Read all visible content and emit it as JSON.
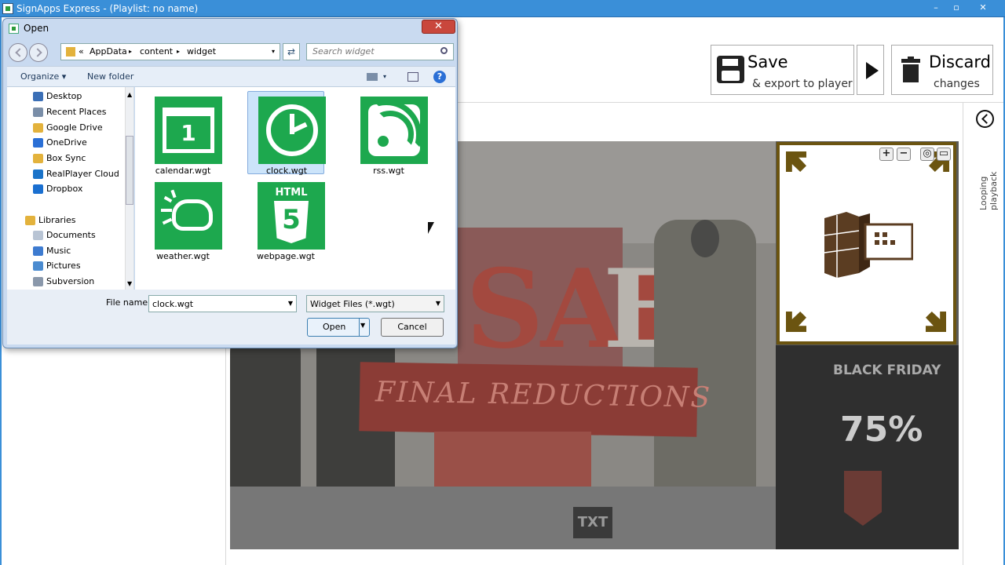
{
  "app": {
    "window_title": "SignApps Express - (Playlist: no name)",
    "window_controls": [
      "–",
      "▫",
      "✕"
    ]
  },
  "toolbar": {
    "save_label": "Save",
    "save_sub": "& export to player",
    "discard_label": "Discard",
    "discard_sub": "changes",
    "looping_label": "Looping playback"
  },
  "stage": {
    "banner_text": "FINAL REDUCTIONS",
    "sale_text": "SAL",
    "sale_e": "E",
    "panel_title": "BLACK FRIDAY",
    "panel_pct": "75%",
    "txt_badge": "TXT",
    "widget_tools": [
      "+",
      "−",
      "◎",
      "▭"
    ]
  },
  "dialog": {
    "title": "Open",
    "close_label": "✕",
    "breadcrumb": [
      "«",
      "AppData",
      "▸",
      "content",
      "▸",
      "widget"
    ],
    "search_placeholder": "Search widget",
    "organize_label": "Organize ▾",
    "new_folder_label": "New folder",
    "nav_items": [
      {
        "label": "Desktop",
        "color": "#3b6fb6"
      },
      {
        "label": "Recent Places",
        "color": "#7a8ea8"
      },
      {
        "label": "Google Drive",
        "color": "#e3b23c"
      },
      {
        "label": "OneDrive",
        "color": "#2a6fd6"
      },
      {
        "label": "Box Sync",
        "color": "#e3b23c"
      },
      {
        "label": "RealPlayer Cloud",
        "color": "#1a73c9"
      },
      {
        "label": "Dropbox",
        "color": "#1a6fd0"
      },
      {
        "label": "Libraries",
        "color": "#e3b23c"
      },
      {
        "label": "Documents",
        "color": "#b8c4d4"
      },
      {
        "label": "Music",
        "color": "#3d7bd0"
      },
      {
        "label": "Pictures",
        "color": "#4a8bd0"
      },
      {
        "label": "Subversion",
        "color": "#8a98ab"
      }
    ],
    "files": [
      {
        "label": "calendar.wgt",
        "icon": "calendar-icon",
        "selected": false
      },
      {
        "label": "clock.wgt",
        "icon": "clock-icon",
        "selected": true
      },
      {
        "label": "rss.wgt",
        "icon": "rss-icon",
        "selected": false
      },
      {
        "label": "weather.wgt",
        "icon": "cloud-icon",
        "selected": false
      },
      {
        "label": "webpage.wgt",
        "icon": "html5-icon",
        "selected": false
      }
    ],
    "calendar_number": "1",
    "html_label": "HTML",
    "html5_digit": "5",
    "filename_label": "File name:",
    "filename_value": "clock.wgt",
    "filetype_value": "Widget Files (*.wgt)",
    "open_label": "Open",
    "cancel_label": "Cancel"
  }
}
